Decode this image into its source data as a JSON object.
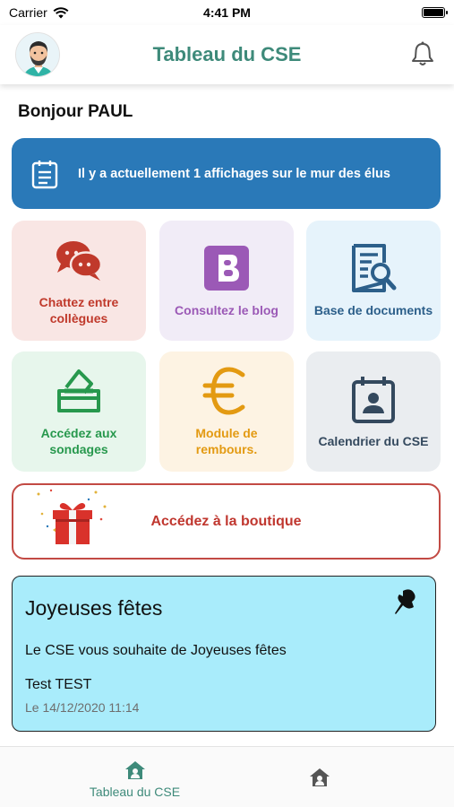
{
  "status_bar": {
    "carrier": "Carrier",
    "time": "4:41 PM"
  },
  "header": {
    "title": "Tableau du CSE"
  },
  "greeting": "Bonjour PAUL",
  "banner": {
    "text": "Il y a actuellement 1 affichages sur le mur des élus",
    "color": "#2a79b8"
  },
  "tiles": [
    {
      "label": "Chattez entre collègues",
      "icon": "chat-bubbles-icon",
      "bg": "#f9e6e4",
      "fg": "#c0392b"
    },
    {
      "label": "Consultez le blog",
      "icon": "blogger-icon",
      "bg": "#f1ecf7",
      "fg": "#9b59b6"
    },
    {
      "label": "Base de documents",
      "icon": "document-search-icon",
      "bg": "#e6f3fb",
      "fg": "#2c5f8a"
    },
    {
      "label": "Accédez aux sondages",
      "icon": "ballot-box-icon",
      "bg": "#e7f6ec",
      "fg": "#27984d"
    },
    {
      "label": "Module de rembours.",
      "icon": "euro-icon",
      "bg": "#fdf3e3",
      "fg": "#e39a12"
    },
    {
      "label": "Calendrier du CSE",
      "icon": "calendar-contact-icon",
      "bg": "#eaedf0",
      "fg": "#34495e"
    }
  ],
  "shop": {
    "label": "Accédez à la boutique"
  },
  "post": {
    "title": "Joyeuses fêtes",
    "message": "Le CSE vous souhaite de Joyeuses fêtes",
    "author": "Test TEST",
    "date": "Le 14/12/2020 11:14"
  },
  "tabbar": {
    "tab1_label": "Tableau du CSE"
  }
}
